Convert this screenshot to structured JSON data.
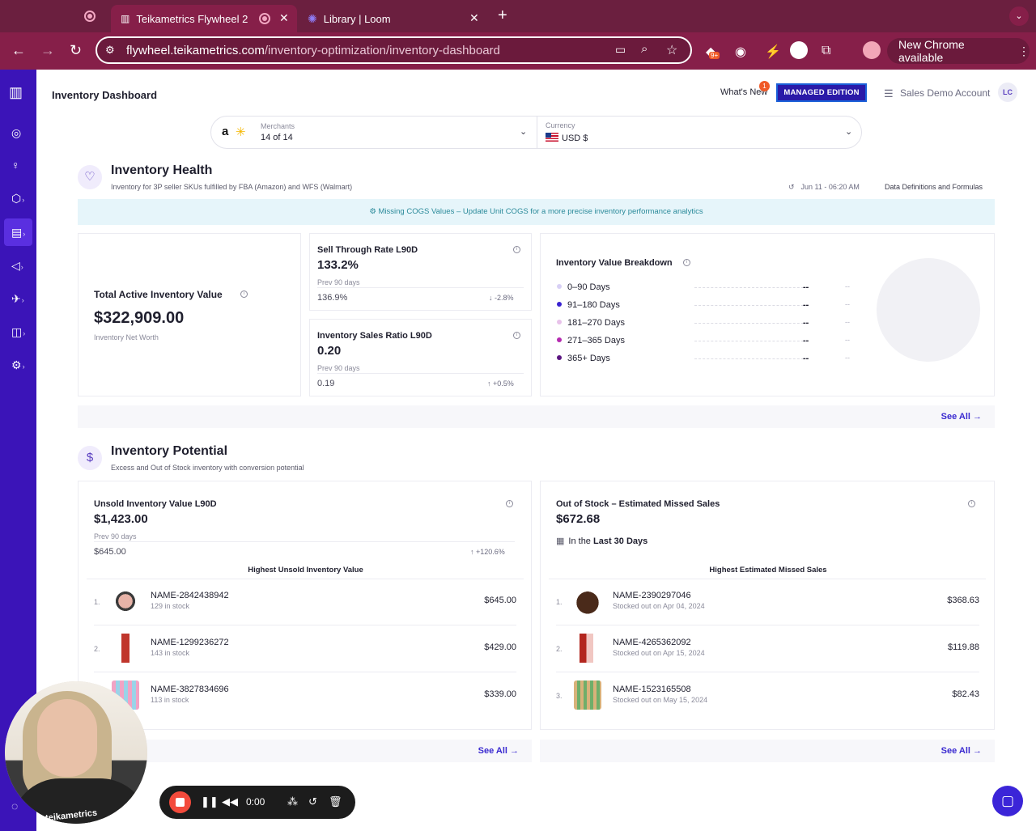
{
  "browser": {
    "tabs": [
      {
        "title": "Teikametrics Flywheel 2",
        "active": true
      },
      {
        "title": "Library | Loom",
        "active": false
      }
    ],
    "url_host": "flywheel.teikametrics.com",
    "url_path": "/inventory-optimization/inventory-dashboard",
    "new_tab": "+",
    "extension_badge": "9+",
    "chrome_update": "New Chrome available",
    "colors": {
      "tabbar": "#6b1f3f",
      "toolbar": "#861f49"
    }
  },
  "sidebar": {
    "color": "#3b14b8",
    "items": [
      "logo-icon",
      "compass-icon",
      "lightbulb-icon",
      "cube-icon",
      "inventory-icon",
      "megaphone-icon",
      "rocket-icon",
      "chart-icon",
      "settings-icon",
      "help-icon"
    ]
  },
  "header": {
    "title": "Inventory Dashboard",
    "whats_new": "What's New",
    "whats_new_count": "1",
    "edition": "MANAGED EDITION",
    "account": "Sales Demo Account",
    "avatar": "LC"
  },
  "filters": {
    "merchants_label": "Merchants",
    "merchants_value": "14 of 14",
    "currency_label": "Currency",
    "currency_value": "USD $"
  },
  "health": {
    "title": "Inventory Health",
    "subtitle": "Inventory for 3P seller SKUs fulfilled by FBA (Amazon) and WFS (Walmart)",
    "timestamp": "Jun 11 - 06:20 AM",
    "definitions": "Data Definitions and Formulas",
    "cogs_link": "Missing COGS Values",
    "cogs_text": " – Update Unit COGS for a more precise inventory performance analytics",
    "total": {
      "label": "Total Active Inventory Value",
      "value": "$322,909.00",
      "sub": "Inventory Net Worth"
    },
    "sell_through": {
      "label": "Sell Through Rate L90D",
      "value": "133.2%",
      "prev_label": "Prev 90 days",
      "prev": "136.9%",
      "delta": "-2.8%",
      "direction": "down"
    },
    "sales_ratio": {
      "label": "Inventory Sales Ratio L90D",
      "value": "0.20",
      "prev_label": "Prev 90 days",
      "prev": "0.19",
      "delta": "+0.5%",
      "direction": "up"
    },
    "breakdown": {
      "label": "Inventory Value Breakdown",
      "rows": [
        {
          "label": "0–90 Days",
          "value": "--",
          "pct": "--",
          "color": "#d8d0f5"
        },
        {
          "label": "91–180 Days",
          "value": "--",
          "pct": "--",
          "color": "#3a22d0"
        },
        {
          "label": "181–270 Days",
          "value": "--",
          "pct": "--",
          "color": "#e8c2ea"
        },
        {
          "label": "271–365 Days",
          "value": "--",
          "pct": "--",
          "color": "#b52ab0"
        },
        {
          "label": "365+ Days",
          "value": "--",
          "pct": "--",
          "color": "#5b1580"
        }
      ]
    },
    "see_all": "See All →"
  },
  "potential": {
    "title": "Inventory Potential",
    "subtitle": "Excess and Out of Stock inventory with conversion potential",
    "unsold": {
      "label": "Unsold Inventory Value L90D",
      "value": "$1,423.00",
      "prev_label": "Prev 90 days",
      "prev": "$645.00",
      "delta": "+120.6%",
      "list_title": "Highest Unsold Inventory Value",
      "items": [
        {
          "num": "1.",
          "name": "NAME-2842438942",
          "sub": "129 in stock",
          "value": "$645.00"
        },
        {
          "num": "2.",
          "name": "NAME-1299236272",
          "sub": "143 in stock",
          "value": "$429.00"
        },
        {
          "num": "3.",
          "name": "NAME-3827834696",
          "sub": "113 in stock",
          "value": "$339.00"
        }
      ],
      "see_all": "See All →"
    },
    "oos": {
      "label": "Out of Stock – Estimated Missed Sales",
      "value": "$672.68",
      "period_prefix": "In the ",
      "period": "Last 30 Days",
      "list_title": "Highest Estimated Missed Sales",
      "items": [
        {
          "num": "1.",
          "name": "NAME-2390297046",
          "sub": "Stocked out on Apr 04, 2024",
          "value": "$368.63"
        },
        {
          "num": "2.",
          "name": "NAME-4265362092",
          "sub": "Stocked out on Apr 15, 2024",
          "value": "$119.88"
        },
        {
          "num": "3.",
          "name": "NAME-1523165508",
          "sub": "Stocked out on May 15, 2024",
          "value": "$82.43"
        }
      ],
      "see_all": "See All →"
    }
  },
  "loom": {
    "time": "0:00",
    "shirt_text": "teikametrics"
  }
}
